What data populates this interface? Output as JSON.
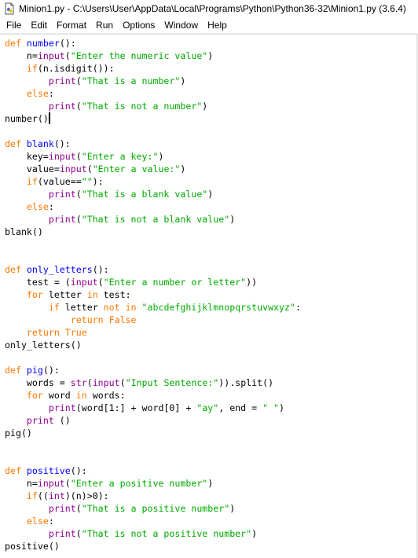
{
  "window": {
    "title": "Minion1.py - C:\\Users\\User\\AppData\\Local\\Programs\\Python\\Python36-32\\Minion1.py (3.6.4)",
    "icon": "python-file-icon"
  },
  "menu": [
    "File",
    "Edit",
    "Format",
    "Run",
    "Options",
    "Window",
    "Help"
  ],
  "colors": {
    "keyword": "#ff7700",
    "builtin": "#900090",
    "string": "#00aa00",
    "definition": "#0000ff"
  },
  "code_lines": [
    [
      [
        "kw",
        "def "
      ],
      [
        "df",
        "number"
      ],
      [
        "",
        "():"
      ]
    ],
    [
      [
        "",
        "    n="
      ],
      [
        "bi",
        "input"
      ],
      [
        "",
        "("
      ],
      [
        "st",
        "\"Enter the numeric value\""
      ],
      [
        "",
        ")"
      ]
    ],
    [
      [
        "",
        "    "
      ],
      [
        "kw",
        "if"
      ],
      [
        "",
        "(n.isdigit()):"
      ]
    ],
    [
      [
        "",
        "        "
      ],
      [
        "bi",
        "print"
      ],
      [
        "",
        "("
      ],
      [
        "st",
        "\"That is a number\""
      ],
      [
        "",
        ")"
      ]
    ],
    [
      [
        "",
        "    "
      ],
      [
        "kw",
        "else"
      ],
      [
        "",
        ":"
      ]
    ],
    [
      [
        "",
        "        "
      ],
      [
        "bi",
        "print"
      ],
      [
        "",
        "("
      ],
      [
        "st",
        "\"That is not a number\""
      ],
      [
        "",
        ")"
      ]
    ],
    [
      [
        "",
        "number()"
      ]
    ],
    [],
    [
      [
        "kw",
        "def "
      ],
      [
        "df",
        "blank"
      ],
      [
        "",
        "():"
      ]
    ],
    [
      [
        "",
        "    key="
      ],
      [
        "bi",
        "input"
      ],
      [
        "",
        "("
      ],
      [
        "st",
        "\"Enter a key:\""
      ],
      [
        "",
        ")"
      ]
    ],
    [
      [
        "",
        "    value="
      ],
      [
        "bi",
        "input"
      ],
      [
        "",
        "("
      ],
      [
        "st",
        "\"Enter a value:\""
      ],
      [
        "",
        ")"
      ]
    ],
    [
      [
        "",
        "    "
      ],
      [
        "kw",
        "if"
      ],
      [
        "",
        "(value=="
      ],
      [
        "st",
        "\"\""
      ],
      [
        "",
        "):"
      ]
    ],
    [
      [
        "",
        "        "
      ],
      [
        "bi",
        "print"
      ],
      [
        "",
        "("
      ],
      [
        "st",
        "\"That is a blank value\""
      ],
      [
        "",
        ")"
      ]
    ],
    [
      [
        "",
        "    "
      ],
      [
        "kw",
        "else"
      ],
      [
        "",
        ":"
      ]
    ],
    [
      [
        "",
        "        "
      ],
      [
        "bi",
        "print"
      ],
      [
        "",
        "("
      ],
      [
        "st",
        "\"That is not a blank value\""
      ],
      [
        "",
        ")"
      ]
    ],
    [
      [
        "",
        "blank()"
      ]
    ],
    [],
    [],
    [
      [
        "kw",
        "def "
      ],
      [
        "df",
        "only_letters"
      ],
      [
        "",
        "():"
      ]
    ],
    [
      [
        "",
        "    test = ("
      ],
      [
        "bi",
        "input"
      ],
      [
        "",
        "("
      ],
      [
        "st",
        "\"Enter a number or letter\""
      ],
      [
        "",
        "))"
      ]
    ],
    [
      [
        "",
        "    "
      ],
      [
        "kw",
        "for"
      ],
      [
        "",
        " letter "
      ],
      [
        "kw",
        "in"
      ],
      [
        "",
        " test:"
      ]
    ],
    [
      [
        "",
        "        "
      ],
      [
        "kw",
        "if"
      ],
      [
        "",
        " letter "
      ],
      [
        "kw",
        "not in"
      ],
      [
        "",
        " "
      ],
      [
        "st",
        "\"abcdefghijklmnopqrstuvwxyz\""
      ],
      [
        "",
        ":"
      ]
    ],
    [
      [
        "",
        "            "
      ],
      [
        "kw",
        "return False"
      ]
    ],
    [
      [
        "",
        "    "
      ],
      [
        "kw",
        "return True"
      ]
    ],
    [
      [
        "",
        "only_letters()"
      ]
    ],
    [],
    [
      [
        "kw",
        "def "
      ],
      [
        "df",
        "pig"
      ],
      [
        "",
        "():"
      ]
    ],
    [
      [
        "",
        "    words = "
      ],
      [
        "bi",
        "str"
      ],
      [
        "",
        "("
      ],
      [
        "bi",
        "input"
      ],
      [
        "",
        "("
      ],
      [
        "st",
        "\"Input Sentence:\""
      ],
      [
        "",
        "))."
      ],
      [
        "",
        "split()"
      ]
    ],
    [
      [
        "",
        "    "
      ],
      [
        "kw",
        "for"
      ],
      [
        "",
        " word "
      ],
      [
        "kw",
        "in"
      ],
      [
        "",
        " words:"
      ]
    ],
    [
      [
        "",
        "        "
      ],
      [
        "bi",
        "print"
      ],
      [
        "",
        "(word[1:] + word[0] + "
      ],
      [
        "st",
        "\"ay\""
      ],
      [
        "",
        ", end = "
      ],
      [
        "st",
        "\" \""
      ],
      [
        "",
        ")"
      ]
    ],
    [
      [
        "",
        "    "
      ],
      [
        "bi",
        "print"
      ],
      [
        "",
        " ()"
      ]
    ],
    [
      [
        "",
        "pig()"
      ]
    ],
    [],
    [],
    [
      [
        "kw",
        "def "
      ],
      [
        "df",
        "positive"
      ],
      [
        "",
        "():"
      ]
    ],
    [
      [
        "",
        "    n="
      ],
      [
        "bi",
        "input"
      ],
      [
        "",
        "("
      ],
      [
        "st",
        "\"Enter a positive number\""
      ],
      [
        "",
        ")"
      ]
    ],
    [
      [
        "",
        "    "
      ],
      [
        "kw",
        "if"
      ],
      [
        "",
        "(("
      ],
      [
        "bi",
        "int"
      ],
      [
        "",
        ")(n)>0):"
      ]
    ],
    [
      [
        "",
        "        "
      ],
      [
        "bi",
        "print"
      ],
      [
        "",
        "("
      ],
      [
        "st",
        "\"That is a positive number\""
      ],
      [
        "",
        ")"
      ]
    ],
    [
      [
        "",
        "    "
      ],
      [
        "kw",
        "else"
      ],
      [
        "",
        ":"
      ]
    ],
    [
      [
        "",
        "        "
      ],
      [
        "bi",
        "print"
      ],
      [
        "",
        "("
      ],
      [
        "st",
        "\"That is not a positive number\""
      ],
      [
        "",
        ")"
      ]
    ],
    [
      [
        "",
        "positive()"
      ]
    ]
  ],
  "cursor_line": 6
}
